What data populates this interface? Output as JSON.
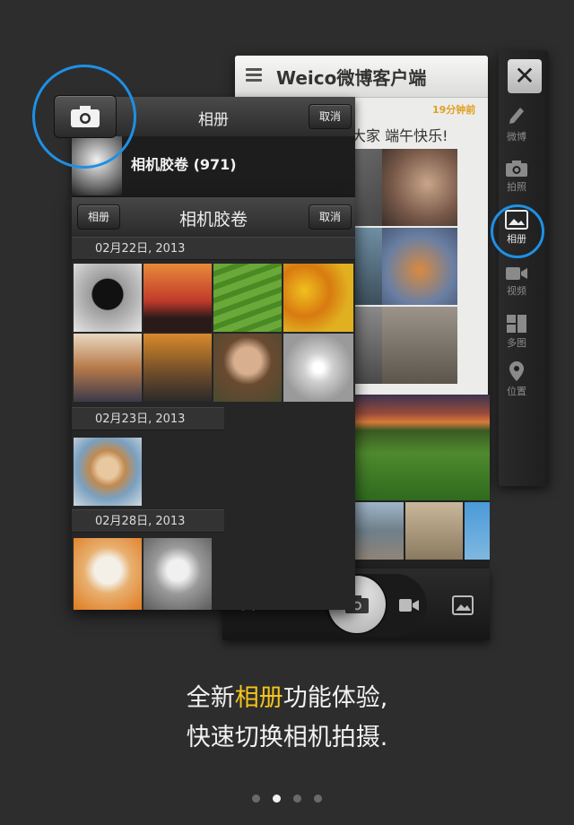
{
  "back_panel": {
    "title": "Weico微博客户端",
    "time_ago": "19分钟前",
    "message": "大家 端午快乐!"
  },
  "side_toolbar": {
    "items": [
      {
        "label": "微博",
        "icon": "pencil-icon"
      },
      {
        "label": "拍照",
        "icon": "camera-icon"
      },
      {
        "label": "相册",
        "icon": "album-icon",
        "active": true
      },
      {
        "label": "视频",
        "icon": "video-icon"
      },
      {
        "label": "多图",
        "icon": "grid-icon"
      },
      {
        "label": "位置",
        "icon": "location-pin-icon"
      }
    ]
  },
  "album_picker": {
    "title": "相册",
    "cancel_label": "取消",
    "album_name": "相机胶卷 (971)"
  },
  "camera_roll": {
    "title": "相机胶卷",
    "back_label": "相册",
    "cancel_label": "取消",
    "sections": [
      {
        "date": "02月22日, 2013"
      },
      {
        "date": "02月23日, 2013"
      },
      {
        "date": "02月28日, 2013"
      }
    ]
  },
  "camera_bar": {
    "album_button_label": "相册"
  },
  "caption": {
    "line1_pre": "全新",
    "line1_highlight": "相册",
    "line1_post": "功能体验,",
    "line2": "快速切换相机拍摄."
  },
  "pager": {
    "total": 4,
    "active": 1
  },
  "colors": {
    "accent_blue": "#1e90e6",
    "highlight_yellow": "#f5c51c"
  }
}
